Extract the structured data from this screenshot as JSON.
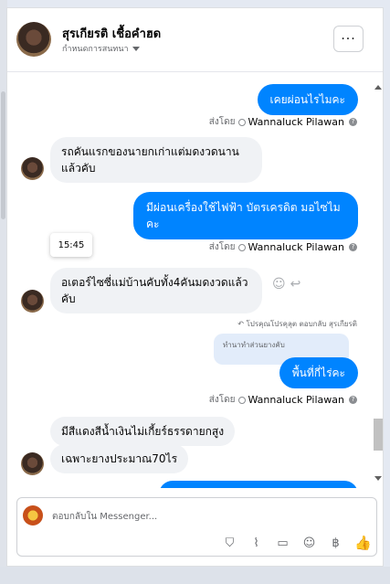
{
  "header": {
    "contact_name": "สุรเกียรติ เชื้อคำฮด",
    "assign_label": "กำหนดการสนทนา",
    "more_label": "···"
  },
  "messages": {
    "out1": "เคยผ่อนไรไมคะ",
    "in1": "รถคันแรกของนายกเก่าแต่มดงวดนานแล้วคับ",
    "out2": "มีผ่อนเครื่องใช้ไฟฟ้า บัตรเครดิต มอไซไมคะ",
    "in2": "อเตอร์ไซซี่แม่บ้านคับทั้ง4คันมดงวดแล้วคับ",
    "reply_header": "↶ โปรคุณโปรคุลุต ตอบกลับ สุรเกียรติ",
    "quoted_text": "ทำนาทำส่วนยางคับ",
    "out3": "พื้นที่กี่ไร่คะ",
    "in3": "มีสีแดงสีน้ำเงินไม่เกี้ยร์ธรรดายกสูง",
    "in4": "เฉพาะยางประมาณ70ไร",
    "sent_by_prefix": "ส่งโดย",
    "sent_by_name": "Wannaluck Pilawan",
    "tooltip_time": "15:45"
  },
  "composer": {
    "placeholder": "ตอบกลับใน Messenger..."
  },
  "icons": [
    "more-icon",
    "gear-icon",
    "attachment-icon",
    "sticker-icon",
    "emoji-icon",
    "baht-icon",
    "like-icon",
    "reply-icon",
    "react-icon"
  ],
  "colors": {
    "outgoing_bubble": "#0084ff",
    "incoming_bubble": "#f0f2f5",
    "quoted_bubble": "#e2ecfa"
  }
}
